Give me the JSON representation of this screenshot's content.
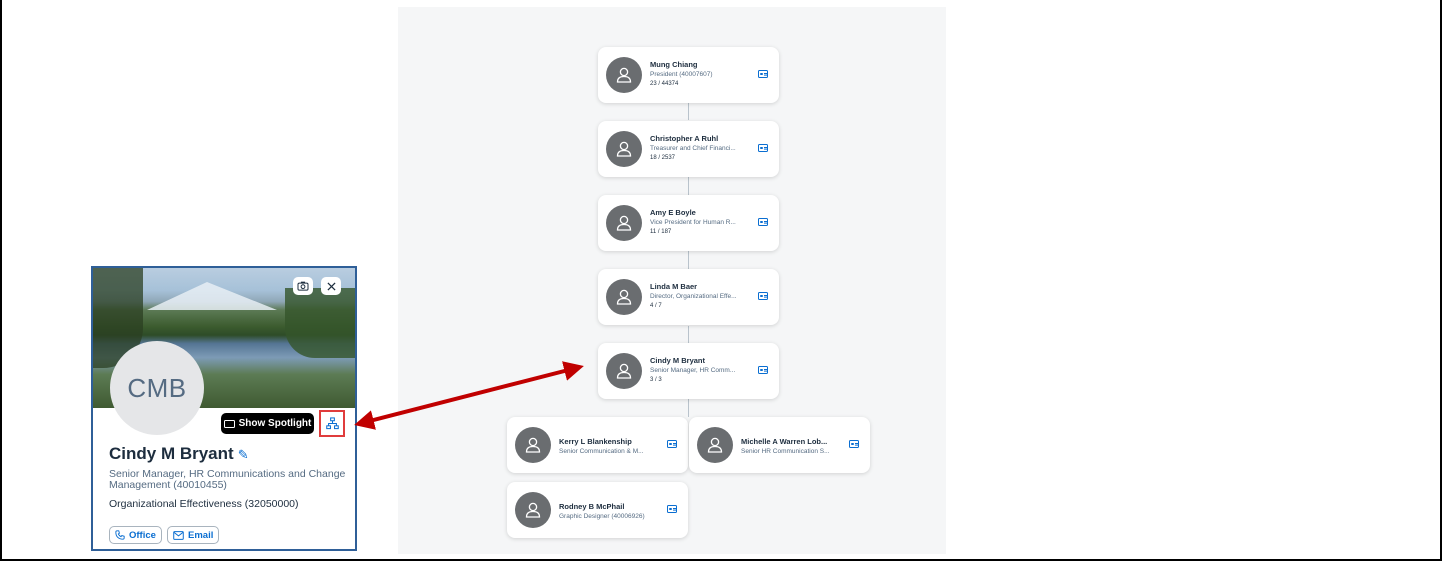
{
  "org_chart": {
    "nodes": [
      {
        "name": "Mung Chiang",
        "title": "President (40007607)",
        "count": "23 / 44374"
      },
      {
        "name": "Christopher A Ruhl",
        "title": "Treasurer and Chief Financi...",
        "count": "18 / 2537"
      },
      {
        "name": "Amy E Boyle",
        "title": "Vice President for Human R...",
        "count": "11 / 187"
      },
      {
        "name": "Linda M Baer",
        "title": "Director, Organizational Effe...",
        "count": "4 / 7"
      },
      {
        "name": "Cindy M Bryant",
        "title": "Senior Manager, HR Comm...",
        "count": "3 / 3"
      }
    ],
    "reports": [
      {
        "name": "Kerry L Blankenship",
        "title": "Senior Communication & M..."
      },
      {
        "name": "Michelle A Warren Lob...",
        "title": "Senior HR Communication S..."
      },
      {
        "name": "Rodney B McPhail",
        "title": "Graphic Designer (40006926)"
      }
    ]
  },
  "profile": {
    "initials": "CMB",
    "name": "Cindy M Bryant",
    "title": "Senior Manager, HR Communications and Change Management (40010455)",
    "department": "Organizational Effectiveness (32050000)",
    "spotlight_label": "Show Spotlight",
    "office_label": "Office",
    "email_label": "Email"
  },
  "colors": {
    "accent": "#0a6ed1",
    "annotation": "#c00000",
    "avatar": "#6a6d70"
  }
}
